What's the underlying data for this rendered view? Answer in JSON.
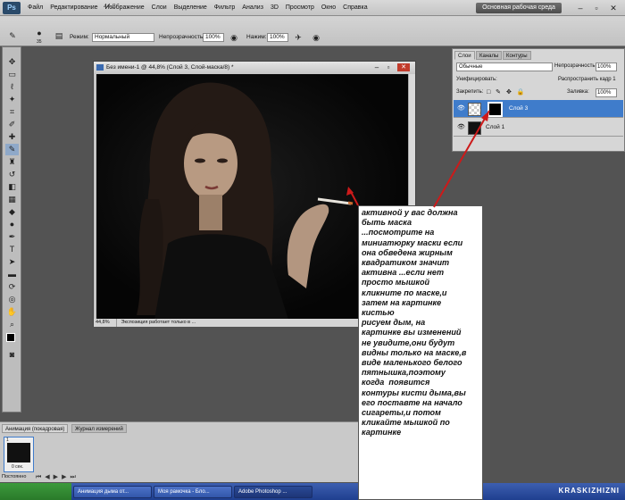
{
  "menubar": {
    "logo": "Ps",
    "items": [
      "Файл",
      "Редактирование",
      "Изображение",
      "Слои",
      "Выделение",
      "Фильтр",
      "Анализ",
      "3D",
      "Просмотр",
      "Окно",
      "Справка"
    ],
    "zoom": "44,8",
    "workspace": "Основная рабочая среда"
  },
  "options": {
    "mode_label": "Режим:",
    "mode_value": "Нормальный",
    "opacity_label": "Непрозрачность:",
    "opacity_value": "100%",
    "pressure_label": "Нажим:",
    "pressure_value": "100%",
    "brush_size": "35"
  },
  "document": {
    "title": "Без имени-1 @ 44,8% (Слой 3, Слой-маска/8) *",
    "status_zoom": "44,8%",
    "status_text": "Экспозиция работает только в ..."
  },
  "layers": {
    "tabs": [
      "Слои",
      "Каналы",
      "Контуры"
    ],
    "blend": "Обычные",
    "opacity_label": "Непрозрачность:",
    "opacity_value": "100%",
    "unify_label": "Унифицировать:",
    "propagate_label": "Распространить кадр 1",
    "lock_label": "Закрепить:",
    "fill_label": "Заливка:",
    "fill_value": "100%",
    "rows": [
      {
        "name": "Слой 3"
      },
      {
        "name": "Слой 1"
      }
    ]
  },
  "animation": {
    "tabs": [
      "Анимация (покадровая)",
      "Журнал измерений"
    ],
    "frame_number": "1",
    "frame_delay": "0 сек.",
    "loop": "Постоянно"
  },
  "taskbar": {
    "items": [
      "Анимация дыма от...",
      "Моя рамочка - Бло...",
      "Adobe Photoshop ..."
    ],
    "watermark": "KRASKIZHIZNI"
  },
  "note": {
    "text": "активной у вас должна\nбыть маска\n...посмотрите на\nминиатюрку маски если\nона обведена жирным\nквадратиком значит\nактивна ...если нет\nпросто мышкой\nкликните по маске,и\nзатем на картинке\nкистью\nрисуем дым, на\nкартинке вы изменений\nне увидите,они будут\nвидны только на маске,в\nвиде маленького белого\nпятнышка,поэтому\nкогда  появится\nконтуры кисти дыма,вы\nего поставте на начало\nсигареты,и потом\nкликайте мышкой по\nкартинке"
  },
  "colors": {
    "arrow": "#cc1a1a",
    "selected_layer": "#3f7ccb"
  }
}
